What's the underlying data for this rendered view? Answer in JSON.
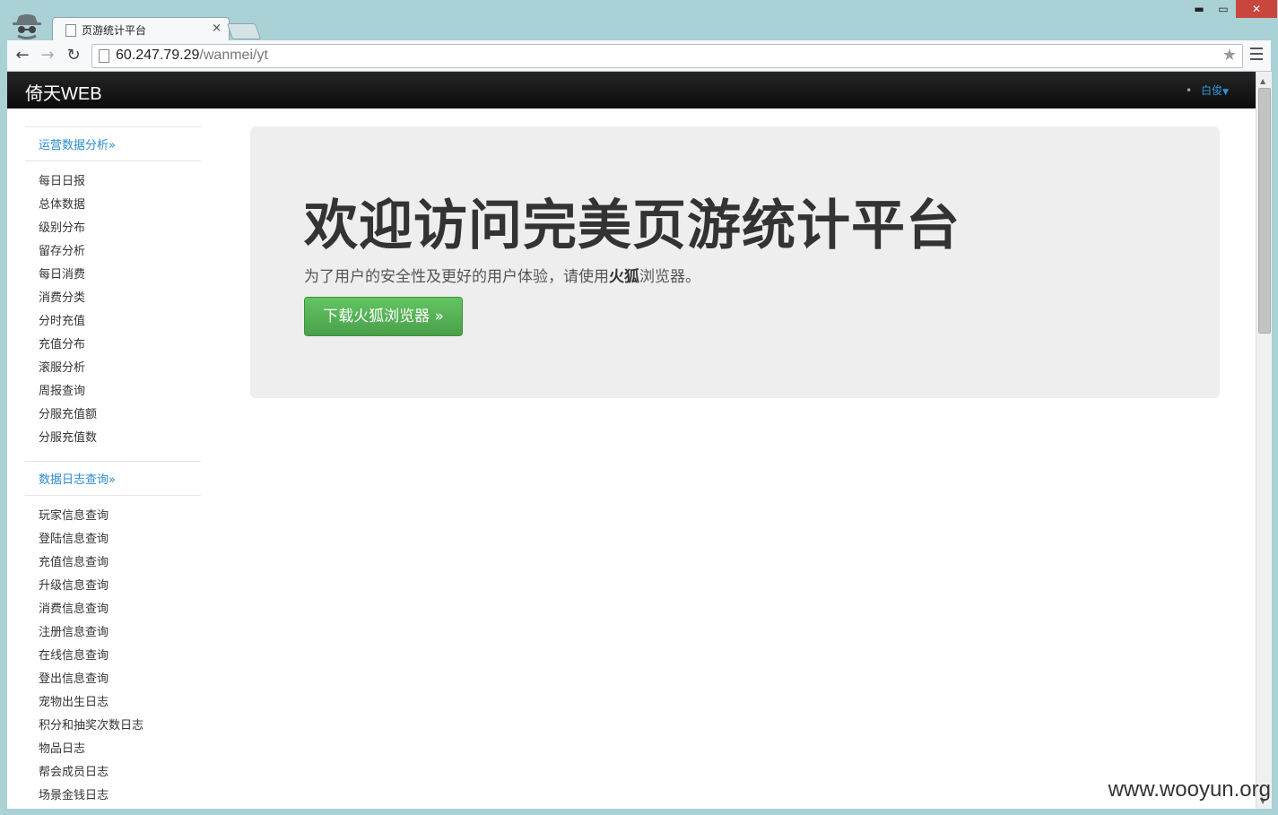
{
  "browser": {
    "tab_title": "页游统计平台",
    "tab_close": "×",
    "url_host": "60.247.79.29",
    "url_path": "/wanmei/yt",
    "window_min": "▬",
    "window_max": "▭",
    "window_close": "✕"
  },
  "navbar": {
    "brand": "倚天WEB",
    "user": "白俊"
  },
  "sidebar": {
    "section1_header": "运营数据分析»",
    "section1_items": [
      "每日日报",
      "总体数据",
      "级别分布",
      "留存分析",
      "每日消费",
      "消费分类",
      "分时充值",
      "充值分布",
      "滚服分析",
      "周报查询",
      "分服充值额",
      "分服充值数"
    ],
    "section2_header": "数据日志查询»",
    "section2_items": [
      "玩家信息查询",
      "登陆信息查询",
      "充值信息查询",
      "升级信息查询",
      "消费信息查询",
      "注册信息查询",
      "在线信息查询",
      "登出信息查询",
      "宠物出生日志",
      "积分和抽奖次数日志",
      "物品日志",
      "帮会成员日志",
      "场景金钱日志"
    ]
  },
  "hero": {
    "title": "欢迎访问完美页游统计平台",
    "subtitle_pre": "为了用户的安全性及更好的用户体验，请使用",
    "subtitle_bold": "火狐",
    "subtitle_post": "浏览器。",
    "button": "下载火狐浏览器 »"
  },
  "watermark": "www.wooyun.org",
  "colors": {
    "link": "#2a8bd0",
    "button_green": "#5bb75b",
    "navbar": "#1b1b1b",
    "hero_bg": "#eeeeee"
  }
}
